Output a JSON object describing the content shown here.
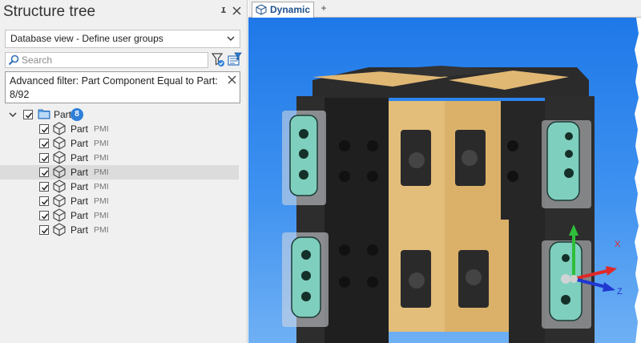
{
  "panel": {
    "title": "Structure tree",
    "view_select": "Database view - Define user groups",
    "search_placeholder": "Search",
    "advanced_filter_text": "Advanced filter: Part Component Equal to Part: 8/92"
  },
  "tree": {
    "root": {
      "label": "Part",
      "count": "8"
    },
    "children": [
      {
        "label": "Part",
        "tag": "PMI"
      },
      {
        "label": "Part",
        "tag": "PMI"
      },
      {
        "label": "Part",
        "tag": "PMI"
      },
      {
        "label": "Part",
        "tag": "PMI"
      },
      {
        "label": "Part",
        "tag": "PMI"
      },
      {
        "label": "Part",
        "tag": "PMI"
      },
      {
        "label": "Part",
        "tag": "PMI"
      },
      {
        "label": "Part",
        "tag": "PMI"
      }
    ]
  },
  "viewport": {
    "tab_label": "Dynamic",
    "add_tab": "+",
    "axes": {
      "x": "X",
      "z": "Z"
    }
  },
  "colors": {
    "accent": "#2f7fd8",
    "viewport_top": "#1e78e8",
    "viewport_bottom": "#6fb0f4",
    "part_gold": "#e3bd7a",
    "part_black": "#2a2a2a",
    "part_teal": "#7fcfbe"
  },
  "icons": {
    "pin": "pin-icon",
    "close": "close-icon",
    "search": "search-icon",
    "filter": "filter-icon",
    "advanced_filter": "advanced-filter-icon",
    "folder": "folder-icon",
    "part": "cube-icon",
    "tab": "cube-icon"
  }
}
